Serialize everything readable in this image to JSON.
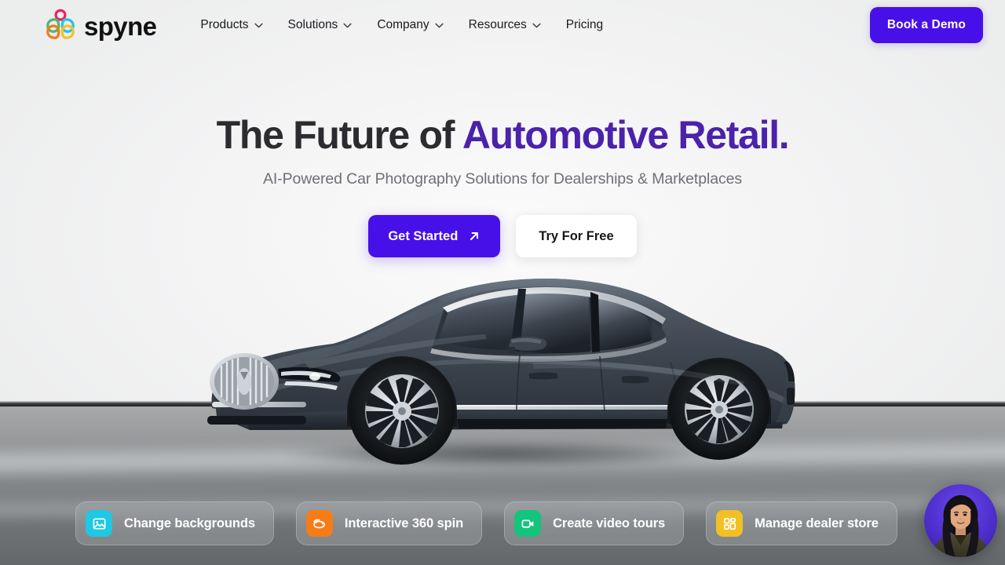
{
  "brand": {
    "name": "spyne",
    "logo_icon": "spyne-flower-logo",
    "logo_colors": {
      "pink": "#e8246b",
      "green": "#4cb872",
      "cyan": "#29c3e0",
      "orange": "#f07c1e",
      "yellow": "#f2c22d"
    }
  },
  "nav": {
    "items": [
      {
        "label": "Products",
        "has_dropdown": true,
        "icon": "chevron-down-icon"
      },
      {
        "label": "Solutions",
        "has_dropdown": true,
        "icon": "chevron-down-icon"
      },
      {
        "label": "Company",
        "has_dropdown": true,
        "icon": "chevron-down-icon"
      },
      {
        "label": "Resources",
        "has_dropdown": true,
        "icon": "chevron-down-icon"
      },
      {
        "label": "Pricing",
        "has_dropdown": false,
        "icon": ""
      }
    ],
    "cta": {
      "label": "Book a Demo",
      "color": "#4710e8"
    }
  },
  "hero": {
    "headline_plain": "The Future of ",
    "headline_accent": "Automotive Retail.",
    "headline_accent_color": "#4b22ab",
    "subhead": "AI-Powered Car Photography Solutions for Dealerships & Marketplaces",
    "primary_cta": {
      "label": "Get Started",
      "icon": "arrow-up-right-icon",
      "color": "#4710e8"
    },
    "secondary_cta": {
      "label": "Try For Free",
      "color": "#ffffff"
    }
  },
  "showcase": {
    "subject": "dark-gray-sedan-car",
    "setting": "photo-studio-backdrop"
  },
  "features": [
    {
      "label": "Change backgrounds",
      "icon": "image-icon",
      "color": "#1fc8e3"
    },
    {
      "label": "Interactive 360 spin",
      "icon": "rotate-360-icon",
      "color": "#f57c17"
    },
    {
      "label": "Create video tours",
      "icon": "video-camera-icon",
      "color": "#13c47c"
    },
    {
      "label": "Manage dealer store",
      "icon": "dashboard-grid-icon",
      "color": "#f2c025"
    }
  ],
  "widget": {
    "name": "video-agent-avatar",
    "alt": "Support agent avatar"
  }
}
